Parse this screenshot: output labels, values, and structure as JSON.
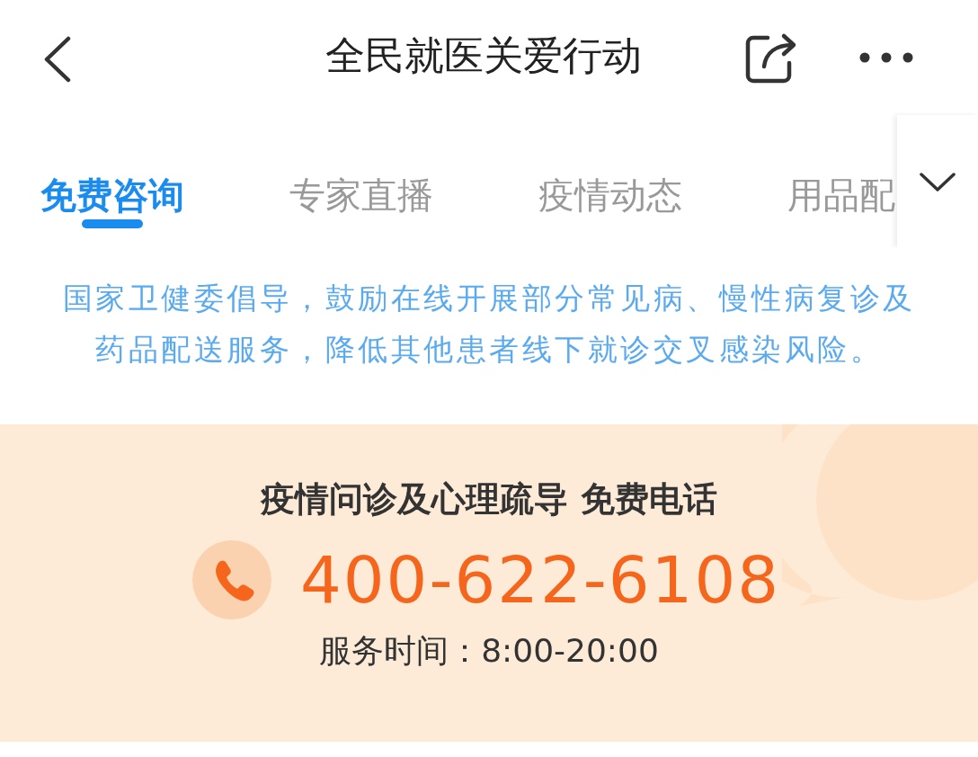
{
  "header": {
    "title": "全民就医关爱行动"
  },
  "tabs": [
    {
      "label": "免费咨询",
      "selected": true
    },
    {
      "label": "专家直播",
      "selected": false
    },
    {
      "label": "疫情动态",
      "selected": false
    },
    {
      "label": "用品配",
      "selected": false
    }
  ],
  "notice": "国家卫健委倡导，鼓励在线开展部分常见病、慢性病复诊及药品配送服务，降低其他患者线下就诊交叉感染风险。",
  "hotline": {
    "title": "疫情问诊及心理疏导 免费电话",
    "phone": "400-622-6108",
    "hours": "服务时间：8:00-20:00"
  }
}
